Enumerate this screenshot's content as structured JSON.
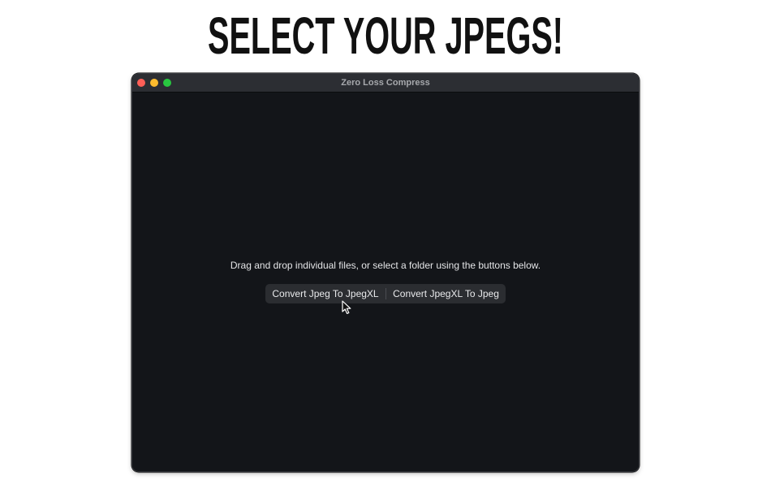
{
  "headline": "SELECT YOUR JPEGS!",
  "window": {
    "title": "Zero Loss Compress",
    "controls": [
      "close",
      "minimize",
      "zoom"
    ]
  },
  "content": {
    "instructions": "Drag and drop individual files, or select a folder using the buttons below.",
    "buttons": [
      {
        "label": "Convert Jpeg To JpegXL"
      },
      {
        "label": "Convert JpegXL To Jpeg"
      }
    ]
  },
  "colors": {
    "window_background": "#131519",
    "titlebar": "#2c2e33",
    "close": "#ff5f57",
    "minimize": "#febc2e",
    "zoom": "#28c840"
  },
  "icons": {
    "pointer": "mouse-pointer-icon"
  }
}
